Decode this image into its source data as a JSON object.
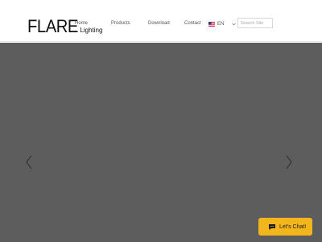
{
  "brand": {
    "name": "FLARE",
    "subname": "Lighting"
  },
  "nav": {
    "items": [
      "Home",
      "Products",
      "Download",
      "Contact"
    ]
  },
  "language": {
    "code": "EN",
    "flag_icon": "us-flag-icon",
    "chevron_icon": "chevron-down-icon"
  },
  "search": {
    "placeholder": "Search Site",
    "value": ""
  },
  "hero": {
    "background_color": "#5e5d5d",
    "prev_icon": "chevron-left-icon",
    "next_icon": "chevron-right-icon"
  },
  "chat": {
    "label": "Let's Chat!",
    "icon": "chat-bubble-icon",
    "color": "#f2b51c"
  }
}
